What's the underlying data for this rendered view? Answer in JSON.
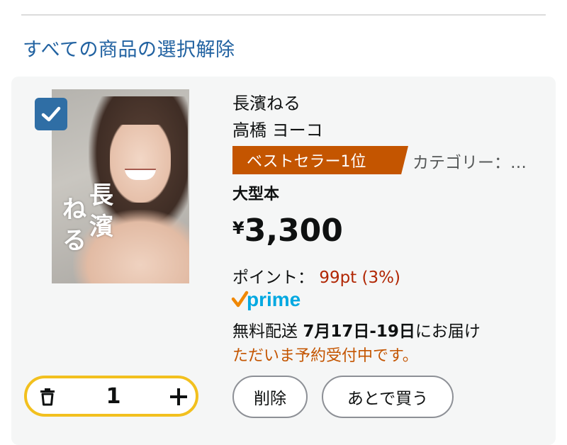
{
  "deselect_all": "すべての商品の選択解除",
  "item": {
    "checked": true,
    "cover": {
      "title_col1": "長濱",
      "title_col2": "ねる"
    },
    "title": "長濱ねる",
    "author": "高橋 ヨーコ",
    "bestseller_badge": "ベストセラー1位",
    "category": "カテゴリー：…",
    "format": "大型本",
    "price_symbol": "¥",
    "price": "3,300",
    "points_label": "ポイント：",
    "points_value": "99pt (3%)",
    "prime_label": "prime",
    "delivery_prefix": "無料配送",
    "delivery_dates": "7月17日-19日",
    "delivery_suffix": "にお届け",
    "preorder_note": "ただいま予約受付中です。",
    "quantity": "1",
    "delete_label": "削除",
    "save_later_label": "あとで買う"
  },
  "colors": {
    "link": "#2162a1",
    "badge": "#c45500",
    "points": "#b12704",
    "prime": "#00a8e1",
    "stepper_border": "#f2c01e",
    "checkbox": "#2f6ea5"
  }
}
